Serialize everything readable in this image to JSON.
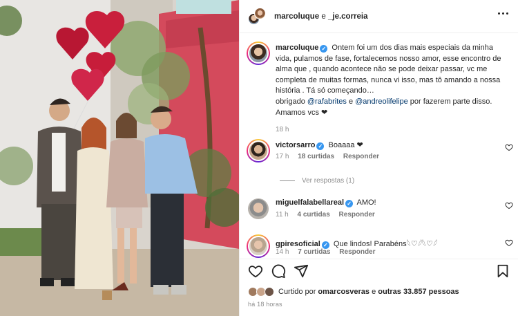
{
  "header": {
    "user1": "marcoluque",
    "connector": " e ",
    "user2": "_je.correia"
  },
  "post": {
    "author": "marcoluque",
    "caption_p1": "Ontem foi um dos dias mais especiais da minha vida, pulamos de fase, fortalecemos nosso amor, esse encontro de alma que , quando acontece não se pode deixar passar, vc me completa de muitas formas, nunca vi isso, mas tô amando a nossa história . Tá só começando…",
    "caption_p2_a": "obrigado ",
    "mention1": "@rafabrites",
    "caption_p2_b": " e ",
    "mention2": "@andreolifelipe",
    "caption_p2_c": " por fazerem parte disso.",
    "caption_p3": "Amamos vcs ❤",
    "time": "18 h"
  },
  "comments": [
    {
      "user": "victorsarro",
      "text": "Boaaaa ❤",
      "time": "17 h",
      "likes": "18 curtidas",
      "reply": "Responder"
    },
    {
      "user": "miguelfalabellareal",
      "text": "AMO!",
      "time": "11 h",
      "likes": "4 curtidas",
      "reply": "Responder"
    },
    {
      "user": "gpiresoficial",
      "text": "Que lindos! Parabéns𓆩♡𓆪𓆩♡𓆪",
      "time": "14 h",
      "likes": "7 curtidas",
      "reply": "Responder"
    }
  ],
  "view_replies": "Ver respostas (1)",
  "liked_by": {
    "prefix": "Curtido por ",
    "user": "omarcosveras",
    "middle": " e ",
    "others": "outras 33.857 pessoas"
  },
  "posted_ago": "há 18 horas",
  "verified_mark": "✓",
  "colors": {
    "verified": "#3897f0",
    "mention": "#00376b",
    "meta": "#8e8e8e",
    "wall": "#d9495a"
  },
  "icons": [
    "more-icon",
    "heart-icon",
    "comment-icon",
    "share-icon",
    "save-icon",
    "verified-icon"
  ]
}
